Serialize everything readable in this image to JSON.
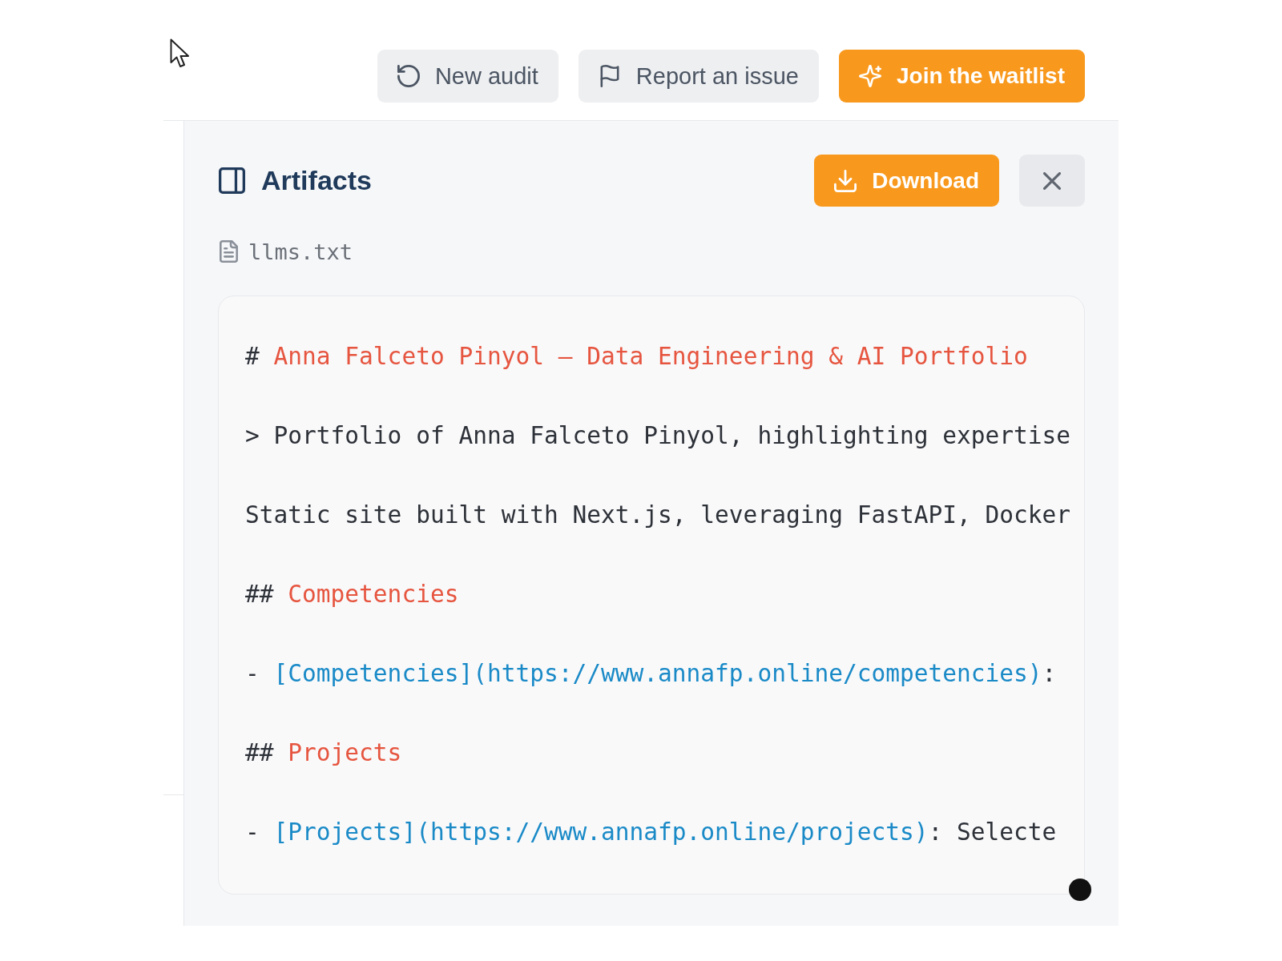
{
  "header": {
    "new_audit_button": {
      "label": "New audit"
    },
    "report_issue_button": {
      "label": "Report an issue"
    },
    "waitlist_button": {
      "label": "Join the waitlist"
    }
  },
  "artifacts_panel": {
    "title": "Artifacts",
    "download_button": {
      "label": "Download"
    },
    "file_name": "llms.txt",
    "code_lines": [
      {
        "segments": [
          {
            "kind": "plain",
            "text": "# "
          },
          {
            "kind": "heading",
            "text": "Anna Falceto Pinyol — Data Engineering & AI Portfolio"
          }
        ]
      },
      {
        "segments": [
          {
            "kind": "plain",
            "text": "> Portfolio of Anna Falceto Pinyol, highlighting expertise"
          }
        ]
      },
      {
        "segments": [
          {
            "kind": "plain",
            "text": "Static site built with Next.js, leveraging FastAPI, Docker"
          }
        ]
      },
      {
        "segments": [
          {
            "kind": "plain",
            "text": "## "
          },
          {
            "kind": "heading",
            "text": "Competencies"
          }
        ]
      },
      {
        "segments": [
          {
            "kind": "plain",
            "text": "- "
          },
          {
            "kind": "link",
            "text": "[Competencies](https://www.annafp.online/competencies)"
          },
          {
            "kind": "plain",
            "text": ":"
          }
        ]
      },
      {
        "segments": [
          {
            "kind": "plain",
            "text": "## "
          },
          {
            "kind": "heading",
            "text": "Projects"
          }
        ]
      },
      {
        "segments": [
          {
            "kind": "plain",
            "text": "- "
          },
          {
            "kind": "link",
            "text": "[Projects](https://www.annafp.online/projects)"
          },
          {
            "kind": "plain",
            "text": ": Selecte"
          }
        ]
      }
    ]
  }
}
